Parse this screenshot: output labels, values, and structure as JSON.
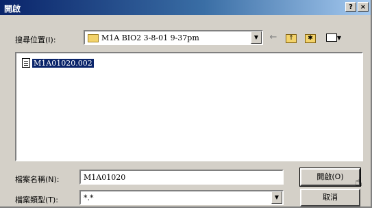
{
  "window": {
    "title": "開啟",
    "help_label": "?",
    "close_label": "×"
  },
  "lookin": {
    "label": "搜尋位置(I):",
    "value": "M1A BIO2 3-8-01 9-37pm"
  },
  "toolbar": {
    "back_icon": "arrow-left-icon",
    "up_icon": "folder-up-icon",
    "newfolder_icon": "new-folder-icon",
    "views_icon": "view-menu-icon"
  },
  "files": [
    {
      "name": "M1A01020.002",
      "selected": true
    }
  ],
  "filename": {
    "label": "檔案名稱(N):",
    "value": "M1A01020"
  },
  "filetype": {
    "label": "檔案類型(T):",
    "value": "*.*"
  },
  "buttons": {
    "open": "開啟(O)",
    "cancel": "取消"
  }
}
